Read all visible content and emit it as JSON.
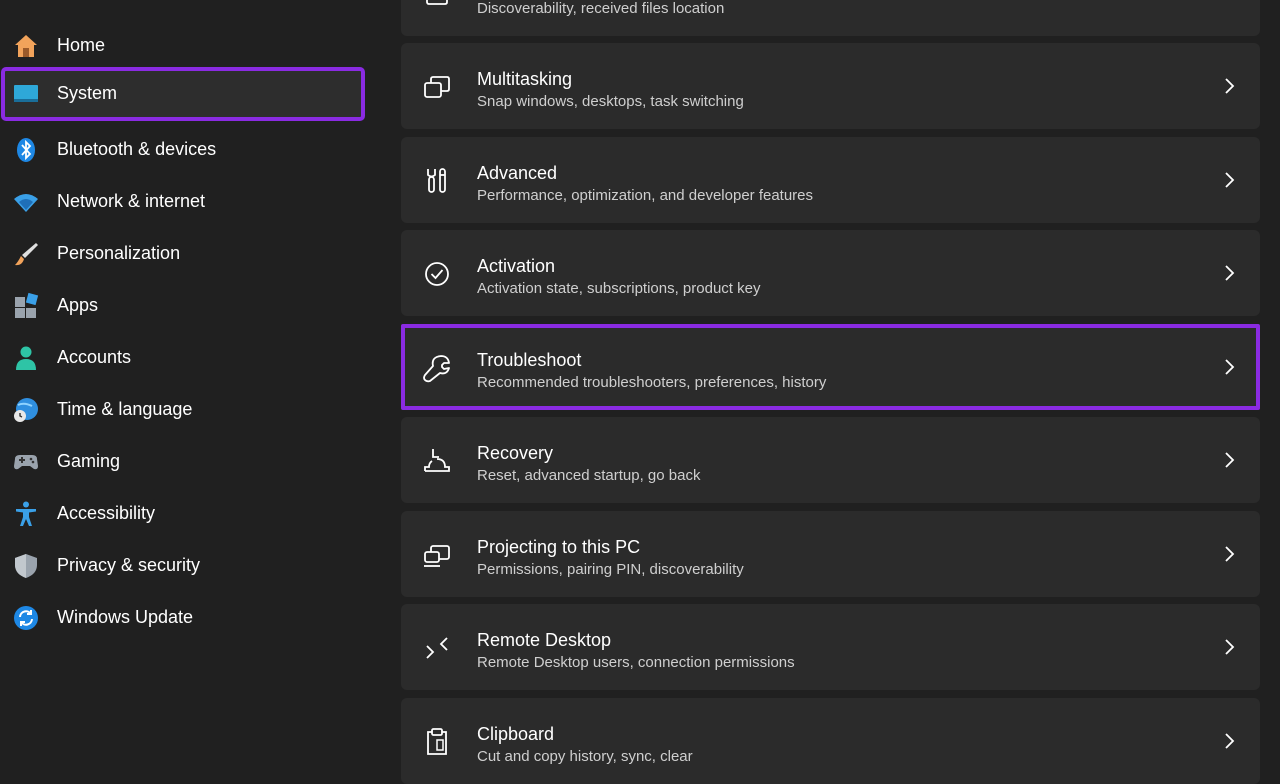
{
  "sidebar": {
    "items": [
      {
        "label": "Home"
      },
      {
        "label": "System"
      },
      {
        "label": "Bluetooth & devices"
      },
      {
        "label": "Network & internet"
      },
      {
        "label": "Personalization"
      },
      {
        "label": "Apps"
      },
      {
        "label": "Accounts"
      },
      {
        "label": "Time & language"
      },
      {
        "label": "Gaming"
      },
      {
        "label": "Accessibility"
      },
      {
        "label": "Privacy & security"
      },
      {
        "label": "Windows Update"
      }
    ],
    "selected": "System"
  },
  "main": {
    "top_partial_subtitle": "Discoverability, received files location",
    "cards": [
      {
        "title": "Multitasking",
        "subtitle": "Snap windows, desktops, task switching",
        "icon": "multitasking-icon"
      },
      {
        "title": "Advanced",
        "subtitle": "Performance, optimization, and developer features",
        "icon": "tools-icon"
      },
      {
        "title": "Activation",
        "subtitle": "Activation state, subscriptions, product key",
        "icon": "check-circle-icon"
      },
      {
        "title": "Troubleshoot",
        "subtitle": "Recommended troubleshooters, preferences, history",
        "icon": "wrench-icon"
      },
      {
        "title": "Recovery",
        "subtitle": "Reset, advanced startup, go back",
        "icon": "recovery-icon"
      },
      {
        "title": "Projecting to this PC",
        "subtitle": "Permissions, pairing PIN, discoverability",
        "icon": "projecting-icon"
      },
      {
        "title": "Remote Desktop",
        "subtitle": "Remote Desktop users, connection permissions",
        "icon": "remote-desktop-icon"
      },
      {
        "title": "Clipboard",
        "subtitle": "Cut and copy history, sync, clear",
        "icon": "clipboard-icon"
      }
    ]
  },
  "colors": {
    "highlight_outline": "#8a2be2",
    "background": "#202020",
    "card": "#2b2b2b"
  }
}
